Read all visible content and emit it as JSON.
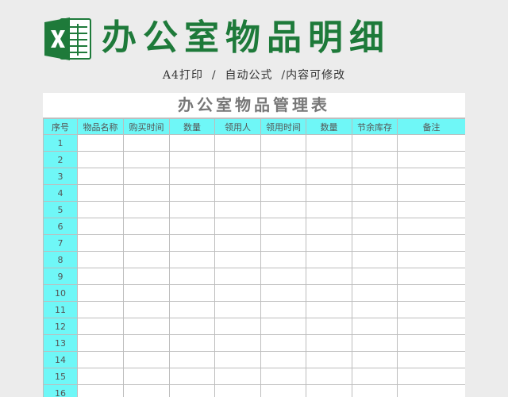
{
  "header": {
    "title": "办公室物品明细",
    "subtitle": "A4打印  /  自动公式  /内容可修改",
    "logo_icon": "excel-logo-icon",
    "brand_color": "#1e7a3a"
  },
  "sheet": {
    "title": "办公室物品管理表",
    "header_color": "#6ff7f7",
    "columns": [
      "序号",
      "物品名称",
      "购买时间",
      "数量",
      "领用人",
      "领用时间",
      "数量",
      "节余库存",
      "备注"
    ],
    "rows": [
      "1",
      "2",
      "3",
      "4",
      "5",
      "6",
      "7",
      "8",
      "9",
      "10",
      "11",
      "12",
      "13",
      "14",
      "15",
      "16"
    ]
  }
}
